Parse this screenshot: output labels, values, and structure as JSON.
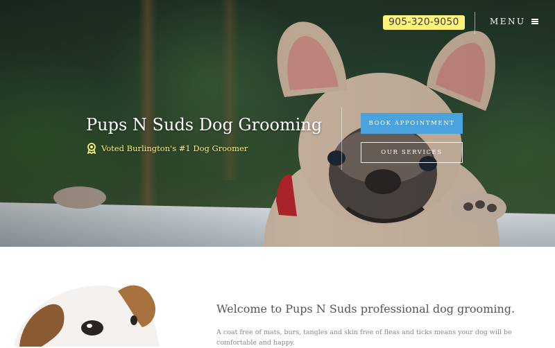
{
  "header": {
    "phone": "905-320-9050",
    "menu_label": "MENU",
    "menu_icon": "hamburger-icon"
  },
  "hero": {
    "title": "Pups N Suds Dog Grooming",
    "tagline": "Voted Burlington's #1 Dog Groomer",
    "tagline_icon": "award-ribbon-icon",
    "book_label": "BOOK APPOINTMENT",
    "services_label": "OUR SERVICES"
  },
  "intro": {
    "heading": "Welcome to Pups N Suds professional dog grooming.",
    "text": "A coat free of mats, burs, tangles and skin free of fleas and ticks means your dog will be comfortable and happy."
  },
  "colors": {
    "accent_blue": "#4aa3dc",
    "phone_yellow": "#fdf27a",
    "tagline_yellow": "#fdf27a",
    "heading_gray": "#555555",
    "body_gray": "#8a8a8a"
  }
}
